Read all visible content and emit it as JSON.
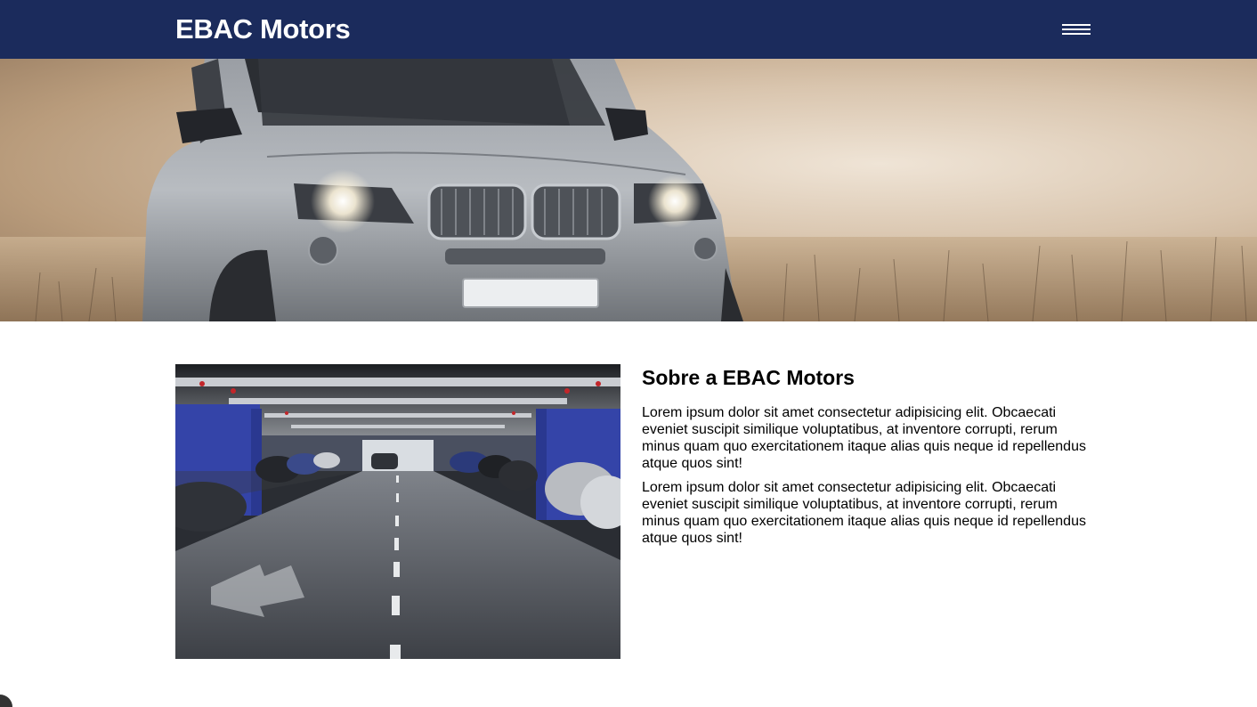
{
  "header": {
    "brand": "EBAC Motors",
    "menu_icon": "hamburger-menu-icon",
    "background_color": "#1b2b5c"
  },
  "hero": {
    "image": "silver-suv-in-misty-field"
  },
  "about": {
    "image": "underground-parking-garage",
    "title": "Sobre a EBAC Motors",
    "paragraphs": [
      "Lorem ipsum dolor sit amet consectetur adipisicing elit. Obcaecati eveniet suscipit similique voluptatibus, at inventore corrupti, rerum minus quam quo exercitationem itaque alias quis neque id repellendus atque quos sint!",
      "Lorem ipsum dolor sit amet consectetur adipisicing elit. Obcaecati eveniet suscipit similique voluptatibus, at inventore corrupti, rerum minus quam quo exercitationem itaque alias quis neque id repellendus atque quos sint!"
    ]
  }
}
